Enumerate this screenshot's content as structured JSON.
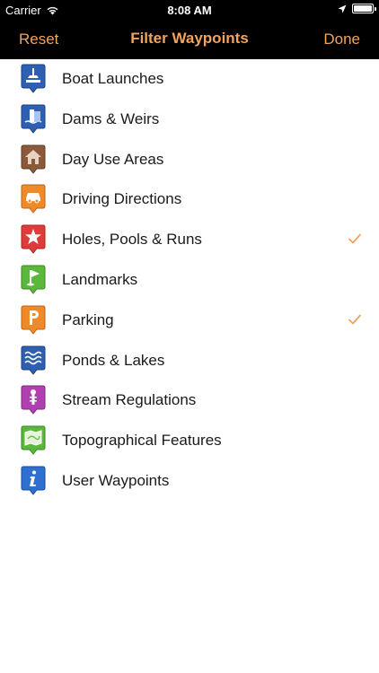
{
  "status": {
    "carrier": "Carrier",
    "time": "8:08 AM"
  },
  "nav": {
    "reset_label": "Reset",
    "title": "Filter Waypoints",
    "done_label": "Done",
    "accent_color": "#f2a35c"
  },
  "items": [
    {
      "label": "Boat Launches",
      "icon": "boat-launch-icon",
      "color": "#2f5fb0",
      "checked": false
    },
    {
      "label": "Dams & Weirs",
      "icon": "dam-icon",
      "color": "#2f5fb0",
      "checked": false
    },
    {
      "label": "Day Use Areas",
      "icon": "cabin-icon",
      "color": "#8a5a3b",
      "checked": false
    },
    {
      "label": "Driving Directions",
      "icon": "car-icon",
      "color": "#ee8a2a",
      "checked": false
    },
    {
      "label": "Holes, Pools & Runs",
      "icon": "star-icon",
      "color": "#e03b3b",
      "checked": true
    },
    {
      "label": "Landmarks",
      "icon": "flag-icon",
      "color": "#5bb83a",
      "checked": false
    },
    {
      "label": "Parking",
      "icon": "parking-icon",
      "color": "#ee8a2a",
      "checked": true
    },
    {
      "label": "Ponds & Lakes",
      "icon": "waves-icon",
      "color": "#2f5fb0",
      "checked": false
    },
    {
      "label": "Stream Regulations",
      "icon": "gauge-icon",
      "color": "#b040b0",
      "checked": false
    },
    {
      "label": "Topographical Features",
      "icon": "topo-map-icon",
      "color": "#5bb83a",
      "checked": false
    },
    {
      "label": "User Waypoints",
      "icon": "info-icon",
      "color": "#2f6fd0",
      "checked": false
    }
  ]
}
